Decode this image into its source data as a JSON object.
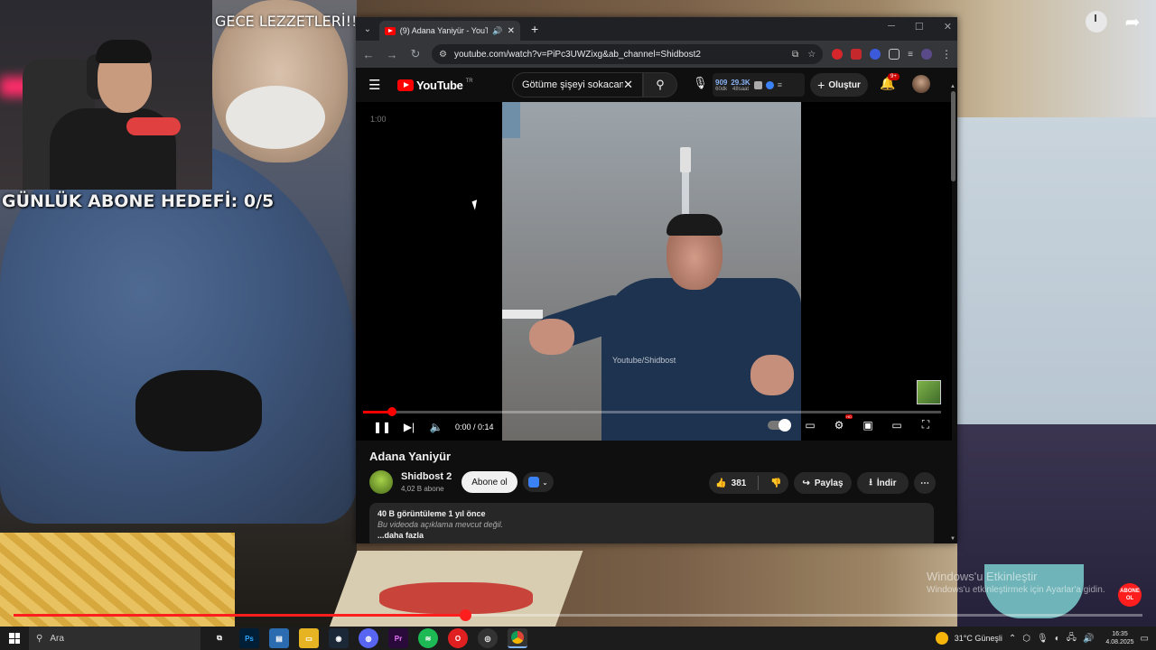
{
  "stream_overlay": {
    "top_banner": "GECE LEZZETLERİ!!",
    "daily_goal": "GÜNLÜK ABONE HEDEFİ: 0/5",
    "progress_fraction": 0.4,
    "watermark_title": "Windows'u Etkinleştir",
    "watermark_sub": "Windows'u etkinleştirmek için Ayarlar'a gidin.",
    "abone_badge": "ABONE OL"
  },
  "browser": {
    "tab_title": "(9) Adana Yaniyür - YouTube",
    "url": "youtube.com/watch?v=PiPc3UWZixg&ab_channel=Shidbost2"
  },
  "youtube": {
    "logo": "YouTube",
    "country_code": "TR",
    "search_query": "Götüme şişeyi sokacam",
    "stats": [
      {
        "big": "909",
        "small": "60dk"
      },
      {
        "big": "29.3K",
        "small": "48saat"
      }
    ],
    "create_label": "Oluştur",
    "notif_count": "9+",
    "video": {
      "corner_time": "1:00",
      "watermark": "Youtube/Shidbost",
      "time_current": "0:00",
      "time_total": "0:14",
      "time_display": "0:00 / 0:14",
      "progress_fraction": 0.05,
      "title": "Adana Yaniyür"
    },
    "channel": {
      "name": "Shidbost 2",
      "subs": "4,02 B abone",
      "subscribe_label": "Abone ol"
    },
    "actions": {
      "likes": "381",
      "share": "Paylaş",
      "download": "İndir"
    },
    "description": {
      "stats": "40 B görüntüleme  1 yıl önce",
      "text": "Bu videoda açıklama mevcut değil.",
      "more": "...daha fazla"
    }
  },
  "taskbar": {
    "search_placeholder": "Ara",
    "weather": "31°C  Güneşli",
    "time": "16:35",
    "date": "4.08.2025"
  }
}
